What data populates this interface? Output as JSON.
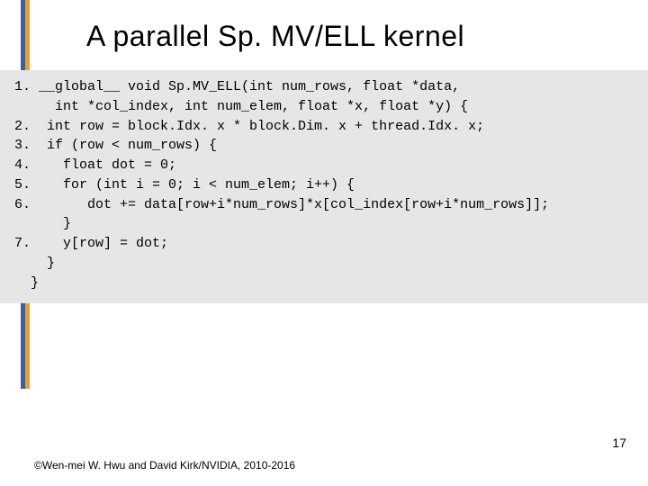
{
  "title": "A parallel Sp. MV/ELL kernel",
  "code": {
    "l1": "1. __global__ void Sp.MV_ELL(int num_rows, float *data,",
    "l1b": "     int *col_index, int num_elem, float *x, float *y) {",
    "blank1": "",
    "l2": "2.  int row = block.Idx. x * block.Dim. x + thread.Idx. x;",
    "l3": "3.  if (row < num_rows) {",
    "l4": "4.    float dot = 0;",
    "l5": "5.    for (int i = 0; i < num_elem; i++) {",
    "l6": "6.       dot += data[row+i*num_rows]*x[col_index[row+i*num_rows]];",
    "l6b": "      }",
    "l7": "7.    y[row] = dot;",
    "l7b": "    }",
    "l7c": "  }"
  },
  "page_number": "17",
  "copyright": "©Wen-mei W. Hwu and David Kirk/NVIDIA, 2010-2016"
}
